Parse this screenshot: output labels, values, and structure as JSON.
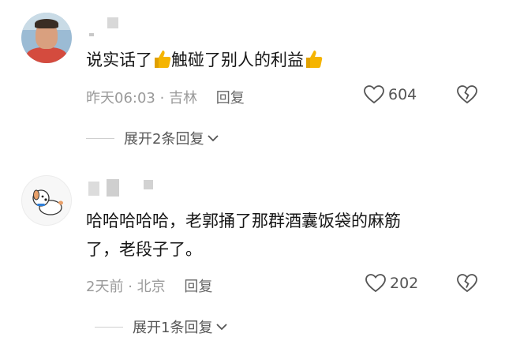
{
  "comments": [
    {
      "text_before": "说实话了",
      "text_middle": "触碰了别人的利益",
      "time": "昨天06:03",
      "location": "吉林",
      "reply_label": "回复",
      "likes": "604",
      "expand_label": "展开2条回复"
    },
    {
      "line1": "哈哈哈哈哈，老郭捅了那群酒囊饭袋的麻筋",
      "line2": "了，老段子了。",
      "time": "2天前",
      "location": "北京",
      "reply_label": "回复",
      "likes": "202",
      "expand_label": "展开1条回复"
    }
  ],
  "colors": {
    "thumb": "#f5b400",
    "meta": "#9a9a9a",
    "text": "#161616"
  }
}
